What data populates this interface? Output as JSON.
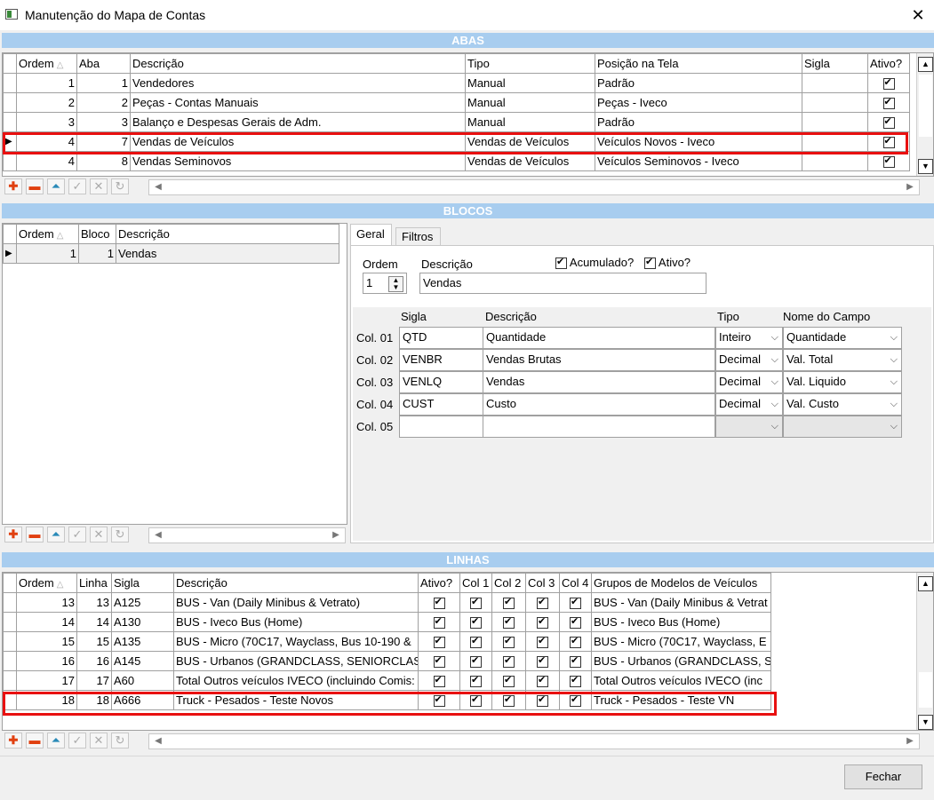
{
  "window": {
    "title": "Manutenção do Mapa de Contas",
    "close_glyph": "✕"
  },
  "abas": {
    "header": "ABAS",
    "columns": [
      "Ordem",
      "Aba",
      "Descrição",
      "Tipo",
      "Posição na Tela",
      "Sigla",
      "Ativo?"
    ],
    "rows": [
      {
        "ordem": "1",
        "aba": "1",
        "descricao": "Vendedores",
        "tipo": "Manual",
        "posicao": "Padrão",
        "sigla": "",
        "ativo": true
      },
      {
        "ordem": "2",
        "aba": "2",
        "descricao": "Peças - Contas Manuais",
        "tipo": "Manual",
        "posicao": "Peças - Iveco",
        "sigla": "",
        "ativo": true
      },
      {
        "ordem": "3",
        "aba": "3",
        "descricao": "Balanço e Despesas Gerais de Adm.",
        "tipo": "Manual",
        "posicao": "Padrão",
        "sigla": "",
        "ativo": true
      },
      {
        "ordem": "4",
        "aba": "7",
        "descricao": "Vendas de Veículos",
        "tipo": "Vendas de Veículos",
        "posicao": "Veículos Novos - Iveco",
        "sigla": "",
        "ativo": true
      },
      {
        "ordem": "4",
        "aba": "8",
        "descricao": "Vendas Seminovos",
        "tipo": "Vendas de Veículos",
        "posicao": "Veículos Seminovos - Iveco",
        "sigla": "",
        "ativo": true
      }
    ]
  },
  "blocos": {
    "header": "BLOCOS",
    "columns": [
      "Ordem",
      "Bloco",
      "Descrição"
    ],
    "rows": [
      {
        "ordem": "1",
        "bloco": "1",
        "descricao": "Vendas"
      }
    ],
    "tabs": [
      "Geral",
      "Filtros"
    ],
    "form": {
      "ordem_label": "Ordem",
      "ordem_value": "1",
      "descricao_label": "Descrição",
      "descricao_value": "Vendas",
      "acumulado_label": "Acumulado?",
      "acumulado": true,
      "ativo_label": "Ativo?",
      "ativo": true
    },
    "cols_headers": [
      "Sigla",
      "Descrição",
      "Tipo",
      "Nome do Campo"
    ],
    "cols": [
      {
        "label": "Col. 01",
        "sigla": "QTD",
        "descricao": "Quantidade",
        "tipo": "Inteiro",
        "campo": "Quantidade"
      },
      {
        "label": "Col. 02",
        "sigla": "VENBR",
        "descricao": "Vendas Brutas",
        "tipo": "Decimal",
        "campo": "Val. Total"
      },
      {
        "label": "Col. 03",
        "sigla": "VENLQ",
        "descricao": "Vendas",
        "tipo": "Decimal",
        "campo": "Val. Liquido"
      },
      {
        "label": "Col. 04",
        "sigla": "CUST",
        "descricao": "Custo",
        "tipo": "Decimal",
        "campo": "Val. Custo"
      },
      {
        "label": "Col. 05",
        "sigla": "",
        "descricao": "",
        "tipo": "",
        "campo": ""
      }
    ]
  },
  "linhas": {
    "header": "LINHAS",
    "columns": [
      "Ordem",
      "Linha",
      "Sigla",
      "Descrição",
      "Ativo?",
      "Col 1",
      "Col 2",
      "Col 3",
      "Col 4",
      "Grupos de Modelos de Veículos"
    ],
    "rows": [
      {
        "ordem": "13",
        "linha": "13",
        "sigla": "A125",
        "descricao": "BUS - Van (Daily Minibus & Vetrato)",
        "grupos": "BUS - Van (Daily Minibus & Vetrat"
      },
      {
        "ordem": "14",
        "linha": "14",
        "sigla": "A130",
        "descricao": "BUS - Iveco Bus (Home)",
        "grupos": "BUS - Iveco Bus (Home)"
      },
      {
        "ordem": "15",
        "linha": "15",
        "sigla": "A135",
        "descricao": "BUS - Micro (70C17, Wayclass, Bus 10-190 &",
        "grupos": "BUS - Micro (70C17, Wayclass, E"
      },
      {
        "ordem": "16",
        "linha": "16",
        "sigla": "A145",
        "descricao": "BUS - Urbanos (GRANDCLASS, SENIORCLASS",
        "grupos": "BUS - Urbanos (GRANDCLASS, S"
      },
      {
        "ordem": "17",
        "linha": "17",
        "sigla": "A60",
        "descricao": "Total Outros veículos IVECO (incluindo Comis:",
        "grupos": "Total Outros veículos IVECO (inc"
      },
      {
        "ordem": "18",
        "linha": "18",
        "sigla": "A666",
        "descricao": "Truck - Pesados - Teste Novos",
        "grupos": "Truck - Pesados - Teste VN"
      }
    ]
  },
  "footer": {
    "fechar": "Fechar"
  },
  "nav_icons": [
    "add-icon",
    "remove-icon",
    "up-icon",
    "check-icon",
    "cancel-icon",
    "refresh-icon"
  ],
  "colors": {
    "header_blue": "#a8cdef",
    "highlight_red": "#e81010"
  }
}
